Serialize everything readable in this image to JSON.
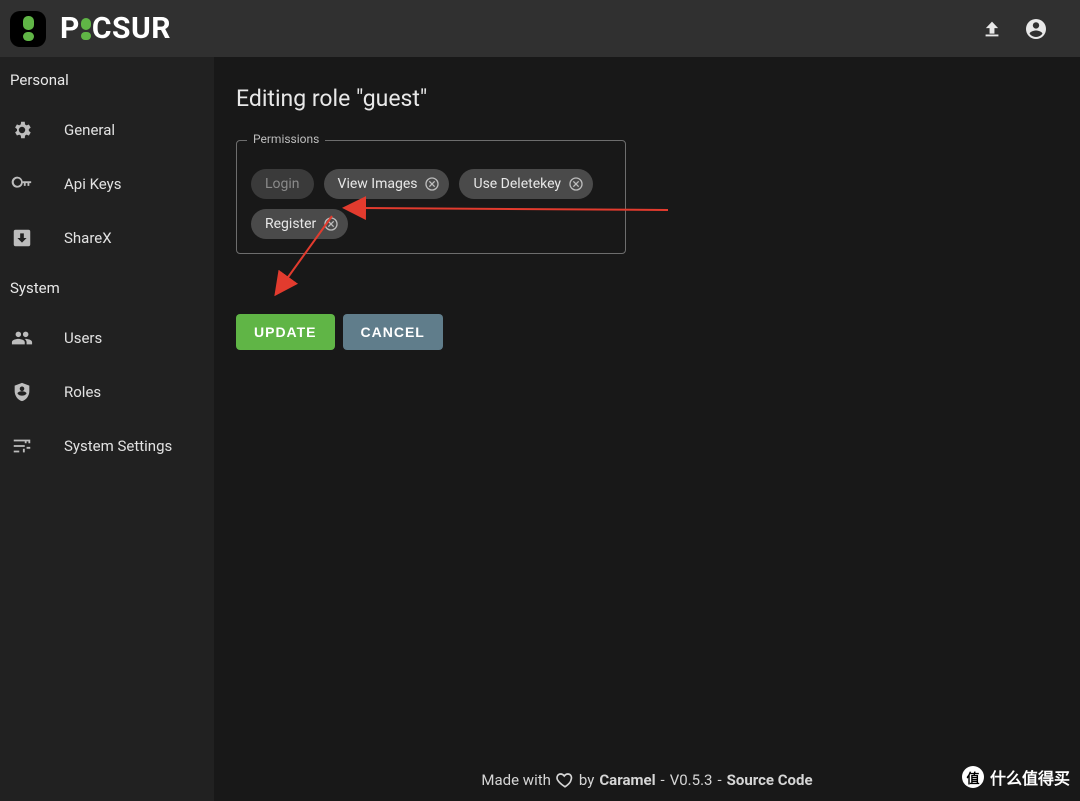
{
  "brand": {
    "name_left": "P",
    "name_right": "CSUR"
  },
  "topbar": {
    "upload": "Upload",
    "account": "Account"
  },
  "sidebar": {
    "section_personal": "Personal",
    "section_system": "System",
    "items": {
      "general": {
        "label": "General"
      },
      "apikeys": {
        "label": "Api Keys"
      },
      "sharex": {
        "label": "ShareX"
      },
      "users": {
        "label": "Users"
      },
      "roles": {
        "label": "Roles"
      },
      "settings": {
        "label": "System Settings"
      }
    }
  },
  "main": {
    "title": "Editing role \"guest\"",
    "permissions_legend": "Permissions",
    "chips": {
      "login": {
        "label": "Login",
        "removable": false
      },
      "view_images": {
        "label": "View Images",
        "removable": true
      },
      "use_deletekey": {
        "label": "Use Deletekey",
        "removable": true
      },
      "register": {
        "label": "Register",
        "removable": true
      }
    },
    "update_label": "Update",
    "cancel_label": "Cancel"
  },
  "footer": {
    "made_with": "Made with",
    "by": "by",
    "author": "Caramel",
    "sep1": " - ",
    "version": "V0.5.3",
    "sep2": " - ",
    "source": "Source Code"
  },
  "watermark": {
    "badge": "值",
    "text": "什么值得买"
  }
}
